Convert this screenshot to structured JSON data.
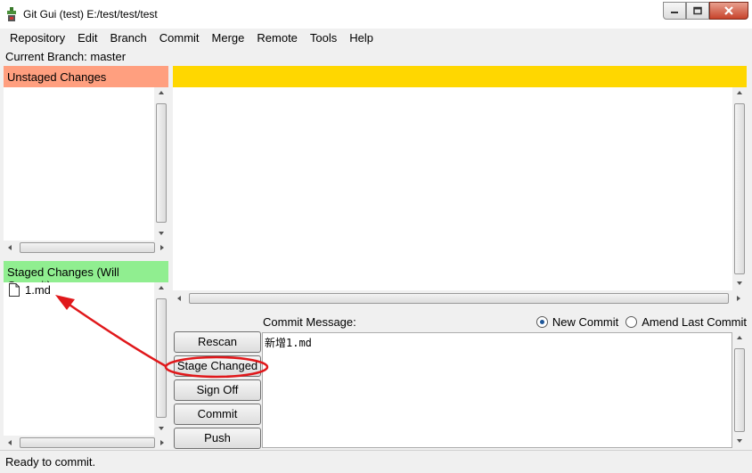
{
  "window": {
    "title": "Git Gui (test) E:/test/test/test",
    "app_icon": "git-gui-icon",
    "controls": [
      "minimize-icon",
      "maximize-icon",
      "close-icon"
    ]
  },
  "menu": [
    "Repository",
    "Edit",
    "Branch",
    "Commit",
    "Merge",
    "Remote",
    "Tools",
    "Help"
  ],
  "branch": {
    "text": "Current Branch: master"
  },
  "unstaged": {
    "header": "Unstaged Changes",
    "files": []
  },
  "staged": {
    "header": "Staged Changes (Will Commit)",
    "files": [
      {
        "name": "1.md",
        "icon": "file-icon"
      }
    ]
  },
  "buttons": {
    "rescan": "Rescan",
    "stage_changed": "Stage Changed",
    "sign_off": "Sign Off",
    "commit": "Commit",
    "push": "Push"
  },
  "commit_area": {
    "label": "Commit Message:",
    "message": "新增1.md",
    "radio_new": "New Commit",
    "radio_amend": "Amend Last Commit",
    "selected": "New Commit"
  },
  "status": {
    "text": "Ready to commit."
  },
  "colors": {
    "unstaged_header": "#ff9f7f",
    "staged_header": "#90ee90",
    "diff_header": "#ffd700",
    "annotation": "#e0181b"
  }
}
